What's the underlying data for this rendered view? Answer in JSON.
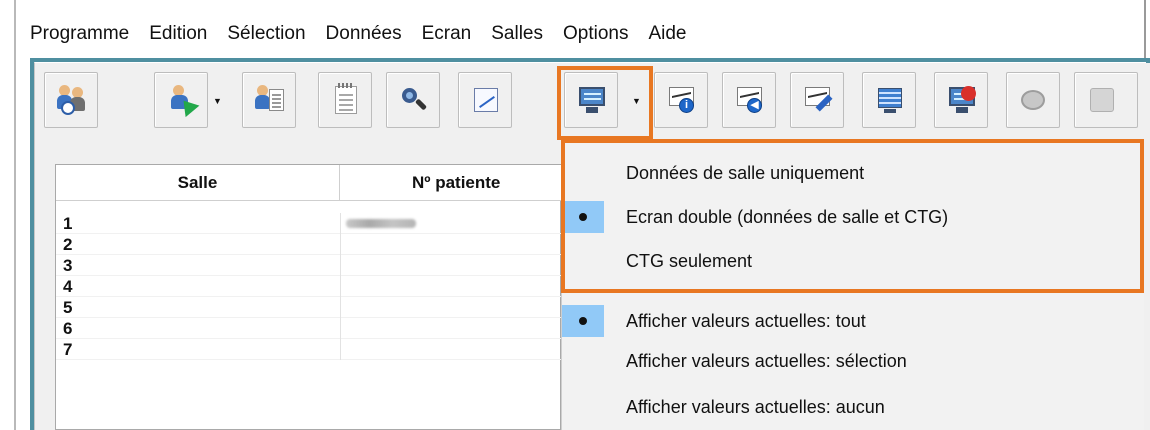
{
  "menubar": {
    "items": [
      "Programme",
      "Edition",
      "Sélection",
      "Données",
      "Ecran",
      "Salles",
      "Options",
      "Aide"
    ]
  },
  "toolbar": {
    "buttons": [
      {
        "icon": "patients-clock-icon"
      },
      {
        "icon": "patient-select-icon"
      },
      {
        "icon": "patient-document-icon"
      },
      {
        "icon": "notepad-icon"
      },
      {
        "icon": "search-icon"
      },
      {
        "icon": "trend-chart-icon"
      },
      {
        "icon": "screen-layout-icon"
      },
      {
        "icon": "trace-info-icon"
      },
      {
        "icon": "trace-back-icon"
      },
      {
        "icon": "trace-edit-icon"
      },
      {
        "icon": "grid-display-icon"
      },
      {
        "icon": "monitor-alarm-icon"
      },
      {
        "icon": "speaker-icon"
      },
      {
        "icon": "disabled-tool-icon"
      }
    ]
  },
  "table": {
    "columns": [
      "Salle",
      "Nº patiente"
    ],
    "rows": [
      {
        "salle": "1",
        "patient_blurred": true
      },
      {
        "salle": "2"
      },
      {
        "salle": "3"
      },
      {
        "salle": "4"
      },
      {
        "salle": "5"
      },
      {
        "salle": "6"
      },
      {
        "salle": "7"
      }
    ]
  },
  "dropdown": {
    "items": [
      {
        "label": "Données de salle uniquement",
        "checked": false
      },
      {
        "label": "Ecran double (données de salle et CTG)",
        "checked": true
      },
      {
        "label": "CTG seulement",
        "checked": false
      },
      {
        "label": "Afficher valeurs actuelles: tout",
        "checked": true
      },
      {
        "label": "Afficher valeurs actuelles: sélection",
        "checked": false
      },
      {
        "label": "Afficher valeurs actuelles: aucun",
        "checked": false
      }
    ]
  },
  "colors": {
    "frame_teal": "#4f8fa0",
    "highlight_orange": "#e87722",
    "check_blue": "#91c9f7"
  }
}
